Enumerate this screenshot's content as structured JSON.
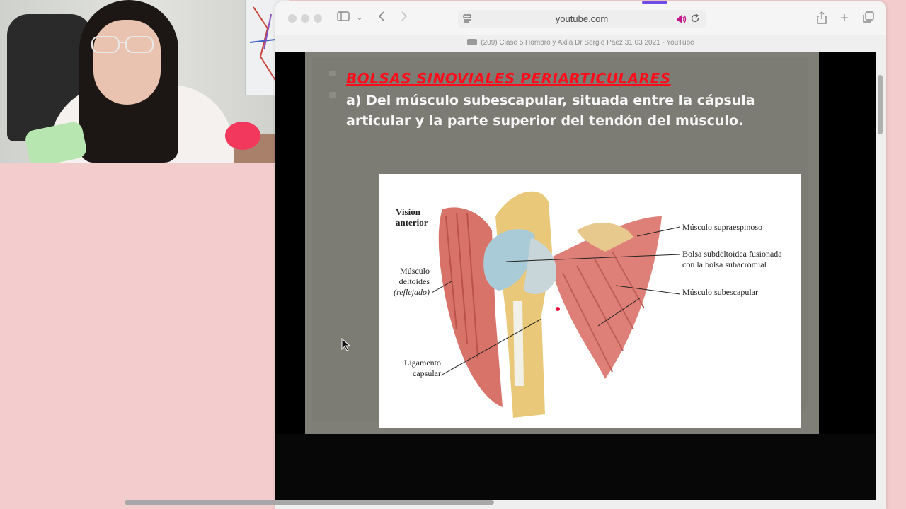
{
  "browser": {
    "address": "youtube.com",
    "tab_title": "(209) Clase 5 Hombro y Axila Dr Sergio Paez 31 03 2021 - YouTube"
  },
  "slide": {
    "heading": "BOLSAS SINOVIALES PERIARTICULARES",
    "paragraph": "a) Del músculo subescapular, situada entre la cápsula articular y la parte superior del tendón del músculo."
  },
  "figure": {
    "title_line1": "Visión",
    "title_line2": "anterior",
    "labels": {
      "deltoides_1": "Músculo",
      "deltoides_2": "deltoides",
      "deltoides_3": "(reflejado)",
      "ligamento_1": "Ligamento",
      "ligamento_2": "capsular",
      "supraespinoso": "Músculo supraespinoso",
      "bolsa_1": "Bolsa subdeltoidea fusionada",
      "bolsa_2": "con la bolsa subacromial",
      "subescapular": "Músculo subescapular"
    }
  },
  "colors": {
    "heading": "#ff0d1a",
    "slide_bg": "#7d7c74",
    "page_bg": "#f3cdcd",
    "accent_purple": "#6e4de6"
  }
}
